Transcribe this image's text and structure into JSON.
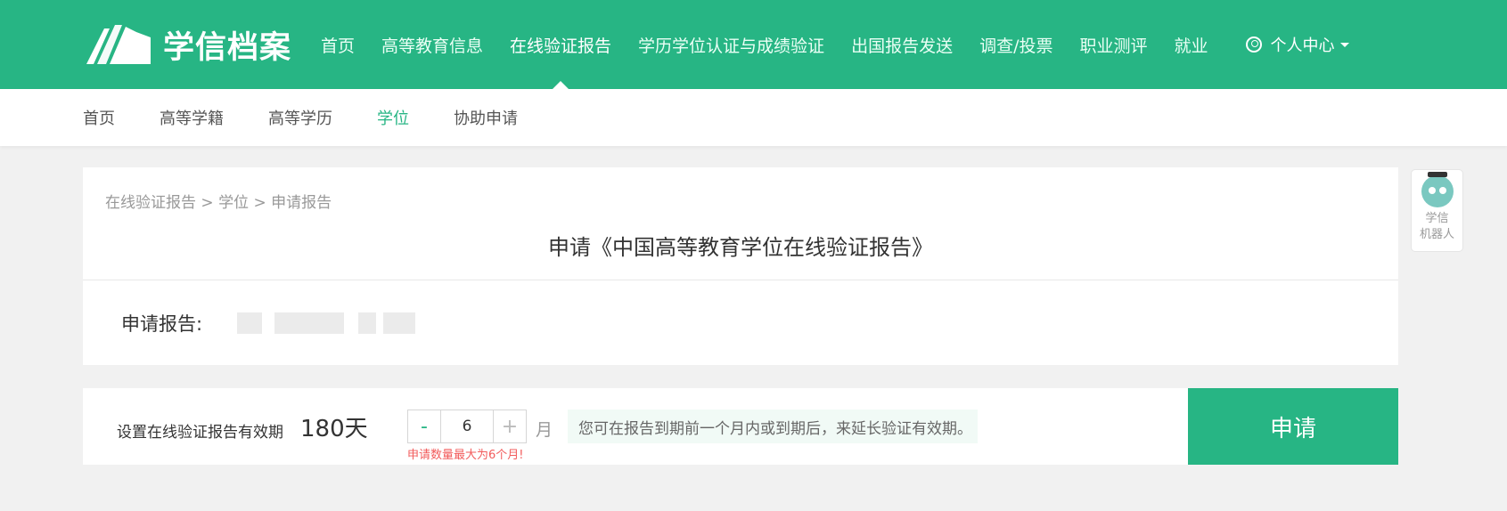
{
  "header": {
    "logo_text": "学信档案",
    "nav": [
      "首页",
      "高等教育信息",
      "在线验证报告",
      "学历学位认证与成绩验证",
      "出国报告发送",
      "调查/投票",
      "职业测评",
      "就业"
    ],
    "user_label": "个人中心"
  },
  "subnav": [
    "首页",
    "高等学籍",
    "高等学历",
    "学位",
    "协助申请"
  ],
  "breadcrumb": [
    "在线验证报告",
    "学位",
    "申请报告"
  ],
  "breadcrumb_sep": ">",
  "title": "申请《中国高等教育学位在线验证报告》",
  "report": {
    "label": "申请报告:"
  },
  "robot": {
    "line1": "学信",
    "line2": "机器人"
  },
  "validity": {
    "label": "设置在线验证报告有效期",
    "days": "180天",
    "minus": "-",
    "value": "6",
    "plus": "+",
    "unit": "月",
    "hint": "您可在报告到期前一个月内或到期后，来延长验证有效期。",
    "warning": "申请数量最大为6个月!",
    "apply_label": "申请"
  },
  "colors": {
    "brand": "#27b584",
    "warning": "#f25b5b"
  }
}
